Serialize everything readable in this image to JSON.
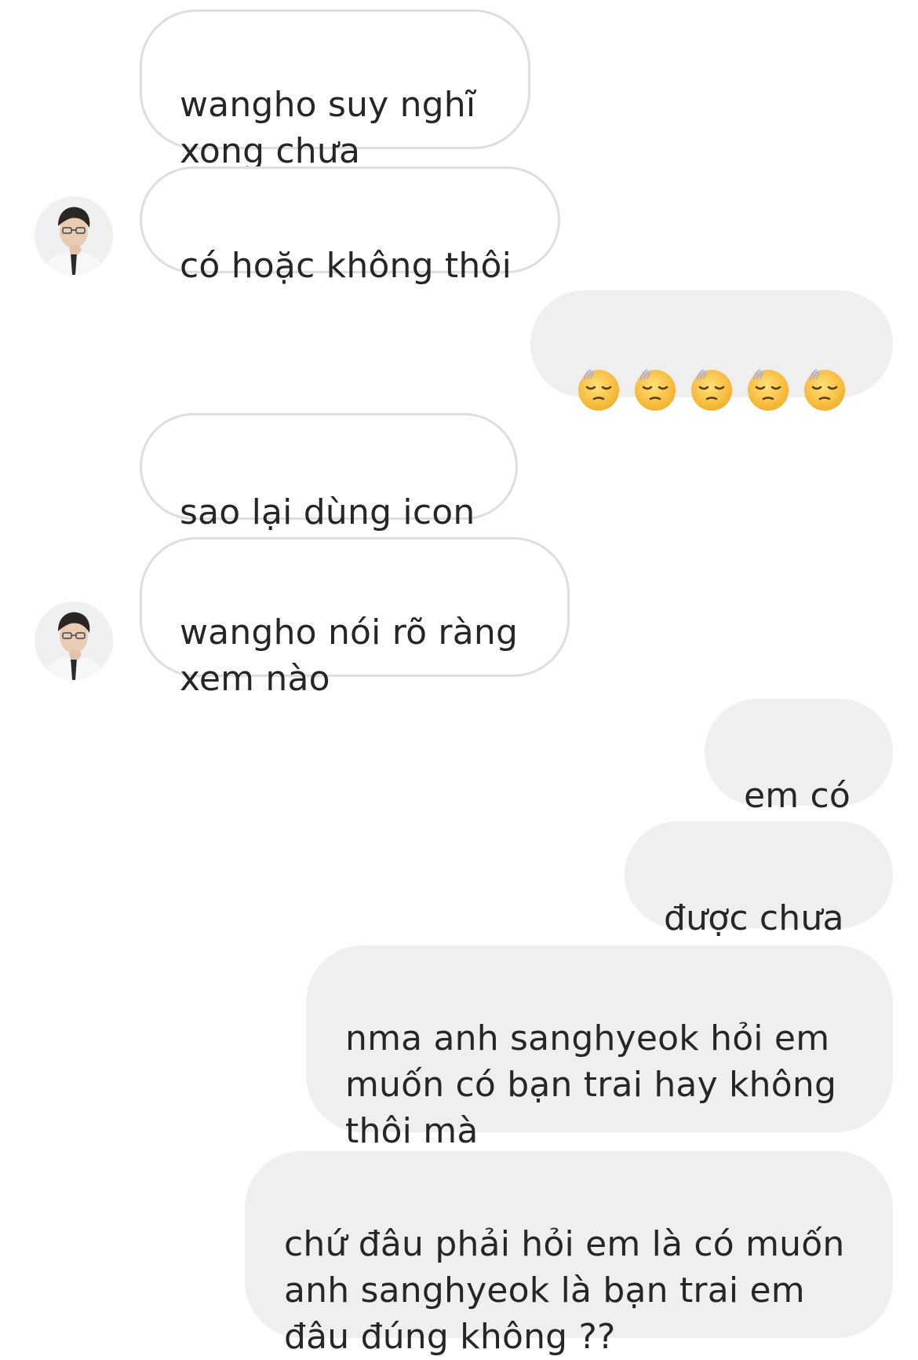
{
  "conversation": {
    "messages": [
      {
        "sender": "them",
        "text": "wangho suy nghĩ\nxong chưa"
      },
      {
        "sender": "them",
        "text": "có hoặc không thôi"
      },
      {
        "sender": "me",
        "emoji": [
          "pensive-face-icon",
          "pensive-face-icon",
          "pensive-face-icon",
          "pensive-face-icon",
          "pensive-face-icon"
        ]
      },
      {
        "sender": "them",
        "text": "sao lại dùng icon"
      },
      {
        "sender": "them",
        "text": "wangho nói rõ ràng\nxem nào"
      },
      {
        "sender": "me",
        "text": "em có"
      },
      {
        "sender": "me",
        "text": "được chưa"
      },
      {
        "sender": "me",
        "text": "nma anh sanghyeok hỏi em\nmuốn có bạn trai hay không\nthôi mà"
      },
      {
        "sender": "me",
        "text": "chứ đâu phải hỏi em là có muốn\nanh sanghyeok là bạn trai em\nđâu đúng không ??"
      }
    ]
  },
  "colors": {
    "incoming_bubble_bg": "#ffffff",
    "incoming_bubble_border": "#dedede",
    "outgoing_bubble_bg": "#efefef",
    "text": "#262626"
  },
  "avatar": {
    "icon": "profile-photo-icon"
  }
}
